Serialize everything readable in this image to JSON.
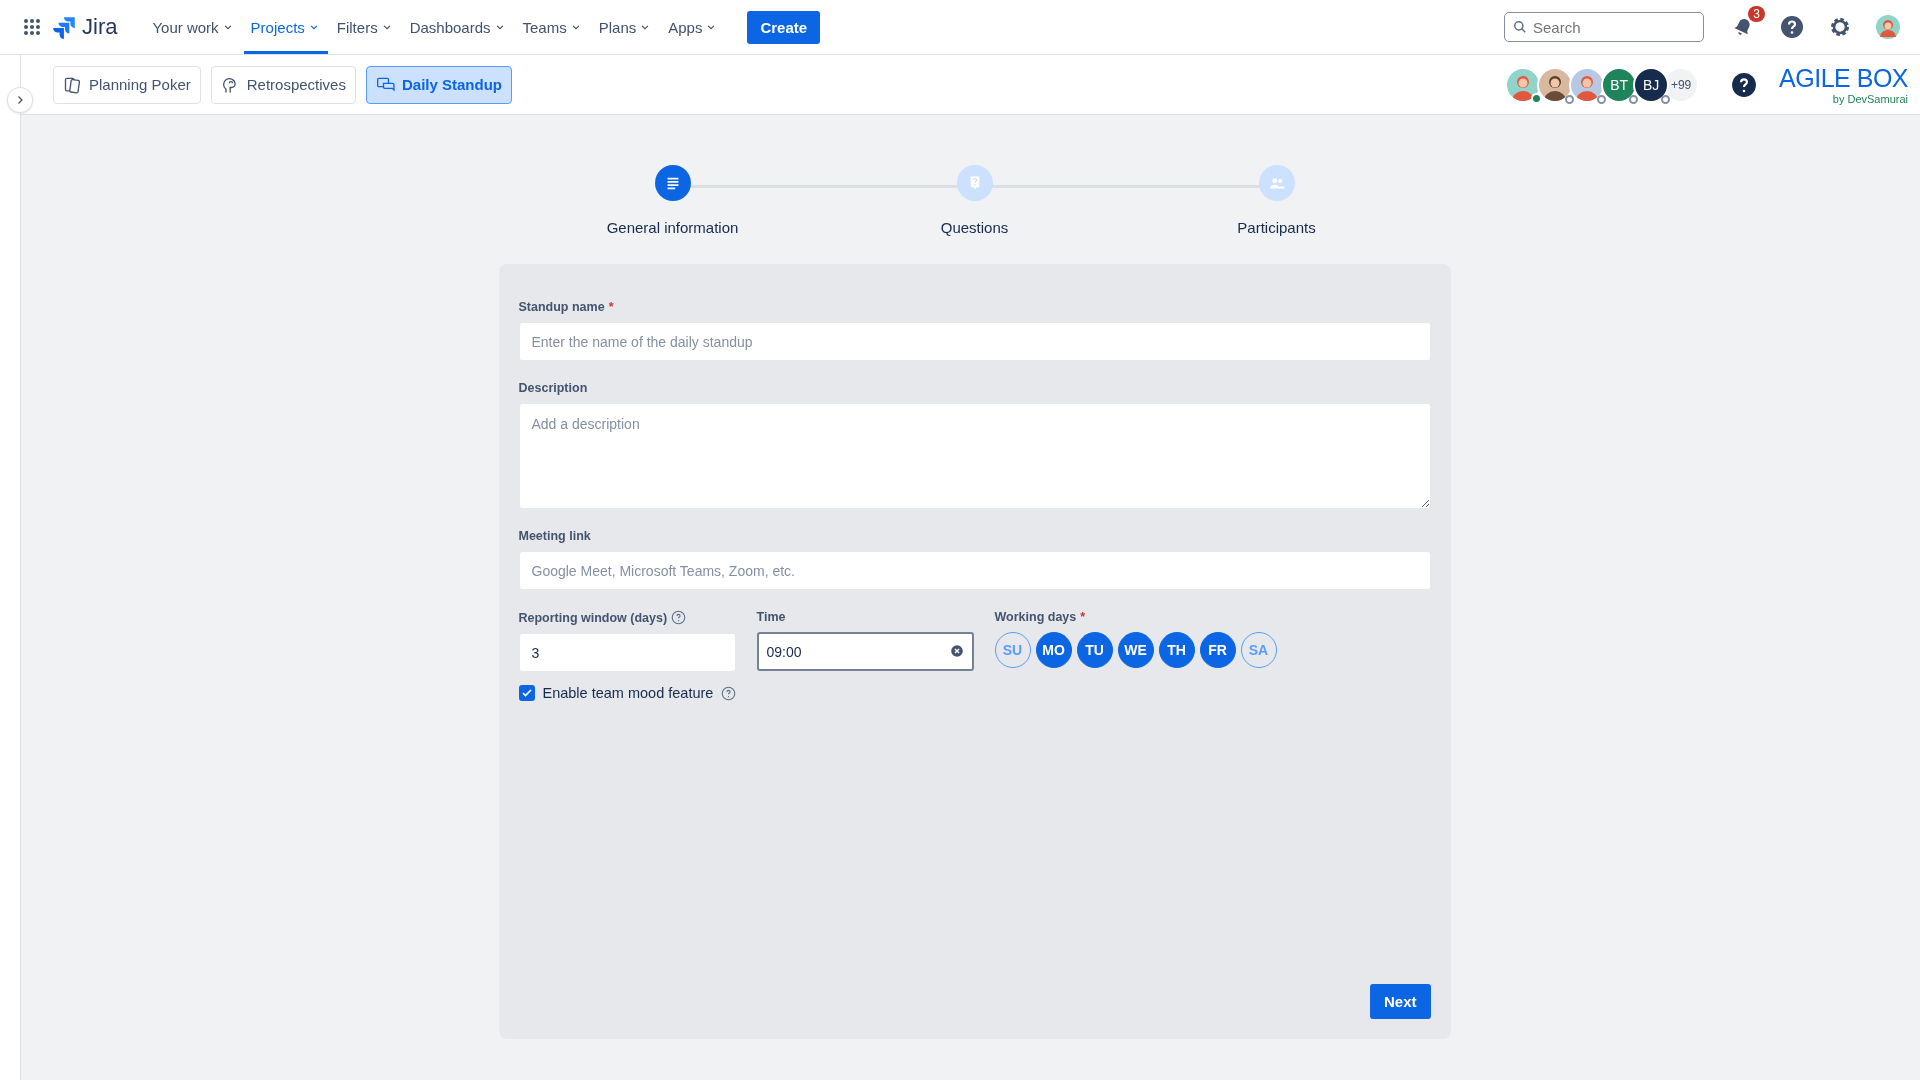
{
  "topnav": {
    "product": "Jira",
    "menu": [
      {
        "label": "Your work",
        "selected": false
      },
      {
        "label": "Projects",
        "selected": true
      },
      {
        "label": "Filters",
        "selected": false
      },
      {
        "label": "Dashboards",
        "selected": false
      },
      {
        "label": "Teams",
        "selected": false
      },
      {
        "label": "Plans",
        "selected": false
      },
      {
        "label": "Apps",
        "selected": false
      }
    ],
    "create": "Create",
    "search": {
      "placeholder": "Search"
    },
    "notification_count": "3"
  },
  "app_tabs": [
    {
      "label": "Planning Poker",
      "kind": "cards",
      "selected": false
    },
    {
      "label": "Retrospectives",
      "kind": "head",
      "selected": false
    },
    {
      "label": "Daily Standup",
      "kind": "chat",
      "selected": true
    }
  ],
  "participants": {
    "avatars": [
      {
        "kind": "picture",
        "online": true
      },
      {
        "kind": "picture",
        "online": false
      },
      {
        "kind": "picture",
        "online": false
      },
      {
        "kind": "initials",
        "initials": "BT",
        "color": "#1f845a",
        "online": false
      },
      {
        "kind": "initials",
        "initials": "BJ",
        "color": "#172b4d",
        "online": false
      }
    ],
    "more": "+99"
  },
  "brand": {
    "title": "AGILE BOX",
    "byline": "by DevSamurai"
  },
  "stepper": [
    {
      "label": "General information",
      "kind": "info",
      "selected": true
    },
    {
      "label": "Questions",
      "kind": "question",
      "selected": false
    },
    {
      "label": "Participants",
      "kind": "people",
      "selected": false
    }
  ],
  "form": {
    "required_mark": "*",
    "fields": [
      {
        "kind": "text",
        "label": "Standup name",
        "required": true,
        "placeholder": "Enter the name of the daily standup"
      },
      {
        "kind": "textarea",
        "label": "Description",
        "required": false,
        "placeholder": "Add a description"
      },
      {
        "kind": "text",
        "label": "Meeting link",
        "required": false,
        "placeholder": "Google Meet, Microsoft Teams, Zoom, etc."
      }
    ],
    "reporting_window": {
      "label": "Reporting window (days)",
      "value": "3"
    },
    "time": {
      "label": "Time",
      "value": "09:00"
    },
    "working_days": {
      "label": "Working days",
      "required": true,
      "days": [
        {
          "label": "SU",
          "selected": false
        },
        {
          "label": "MO",
          "selected": true
        },
        {
          "label": "TU",
          "selected": true
        },
        {
          "label": "WE",
          "selected": true
        },
        {
          "label": "TH",
          "selected": true
        },
        {
          "label": "FR",
          "selected": true
        },
        {
          "label": "SA",
          "selected": false
        }
      ]
    },
    "mood_feature": {
      "label": "Enable team mood feature",
      "checked": true
    },
    "next": "Next"
  }
}
